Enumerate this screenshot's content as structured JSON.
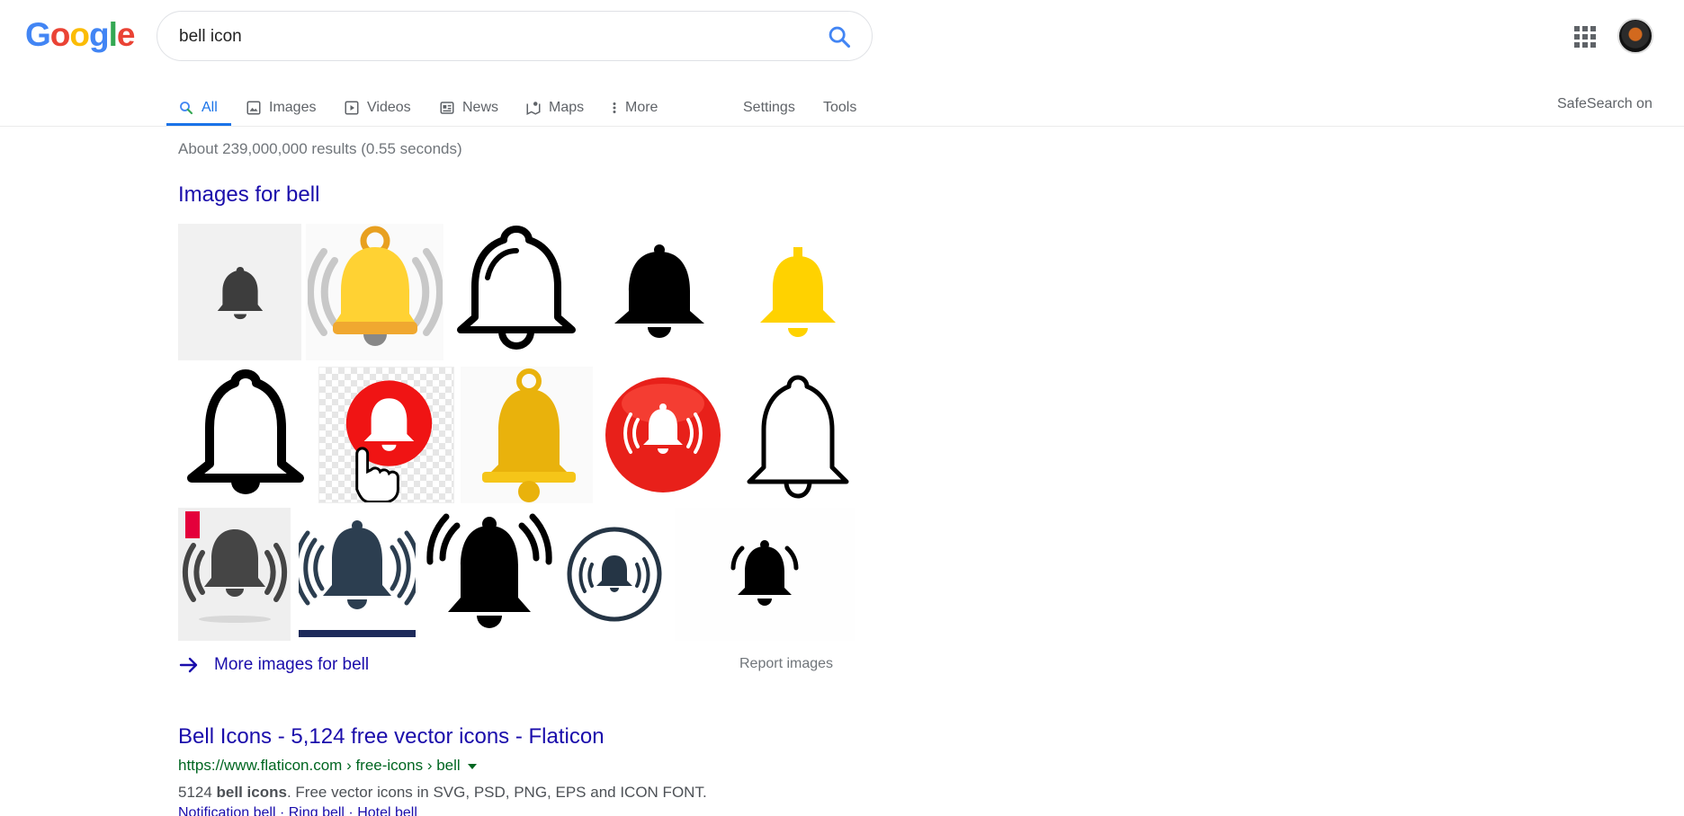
{
  "header": {
    "logo_text": "Google",
    "search_query": "bell icon"
  },
  "tabs": [
    {
      "label": "All",
      "icon": "search-icon",
      "active": true
    },
    {
      "label": "Images",
      "icon": "image-icon"
    },
    {
      "label": "Videos",
      "icon": "video-icon"
    },
    {
      "label": "News",
      "icon": "news-icon"
    },
    {
      "label": "Maps",
      "icon": "map-icon"
    },
    {
      "label": "More",
      "icon": "more-vert-icon"
    }
  ],
  "tools": {
    "settings": "Settings",
    "tools": "Tools",
    "safesearch": "SafeSearch on"
  },
  "stats": "About 239,000,000 results (0.55 seconds)",
  "images_section": {
    "heading": "Images for bell",
    "more_label": "More images for bell",
    "report_label": "Report images"
  },
  "result": {
    "title": "Bell Icons - 5,124 free vector icons - Flaticon",
    "url": "https://www.flaticon.com › free-icons › bell",
    "snippet_prefix": "5124 ",
    "snippet_bold": "bell icons",
    "snippet_suffix": ". Free vector icons in SVG, PSD, PNG, EPS and ICON FONT.",
    "links": "Notification bell · Ring bell · Hotel bell"
  },
  "colors": {
    "accent": "#1a73e8",
    "link": "#1a0dab",
    "url_green": "#006621",
    "bell_yellow": "#ffd200",
    "bell_gold": "#e9b20c",
    "bell_red": "#e8201a",
    "bell_navy": "#2c3e50"
  }
}
